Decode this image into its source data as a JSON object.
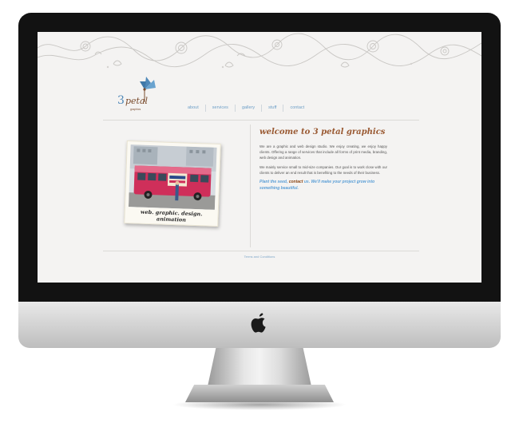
{
  "site": {
    "logo": {
      "number": "3",
      "word": "petal",
      "sub": "graphics"
    },
    "nav": [
      {
        "label": "about"
      },
      {
        "label": "services"
      },
      {
        "label": "gallery"
      },
      {
        "label": "stuff"
      },
      {
        "label": "contact"
      }
    ],
    "heading": "welcome to 3 petal graphics",
    "paragraphs": [
      "We are a graphic and web design studio. We enjoy creating, we enjoy happy clients. Offering a range of services that include all forms of print media, branding, web design and animation.",
      "We mainly service small to mid-size companies. Our goal is to work close with our clients to deliver an end result that is benefiting to the needs of their business."
    ],
    "tagline": {
      "before": "Plant the seed, ",
      "link": "contact",
      "after": " us. We'll make your project grow into something beautiful."
    },
    "polaroid_caption": "web. graphic. design. animation",
    "footer_link": "Terms and Conditions"
  },
  "icons": {
    "brand": "apple-logo-icon",
    "camera": "camera-icon",
    "flower": "flower-logo-icon"
  },
  "colors": {
    "accent_blue": "#6fa0c8",
    "accent_brown": "#9a5a33",
    "screen_bg": "#f4f3f2"
  }
}
